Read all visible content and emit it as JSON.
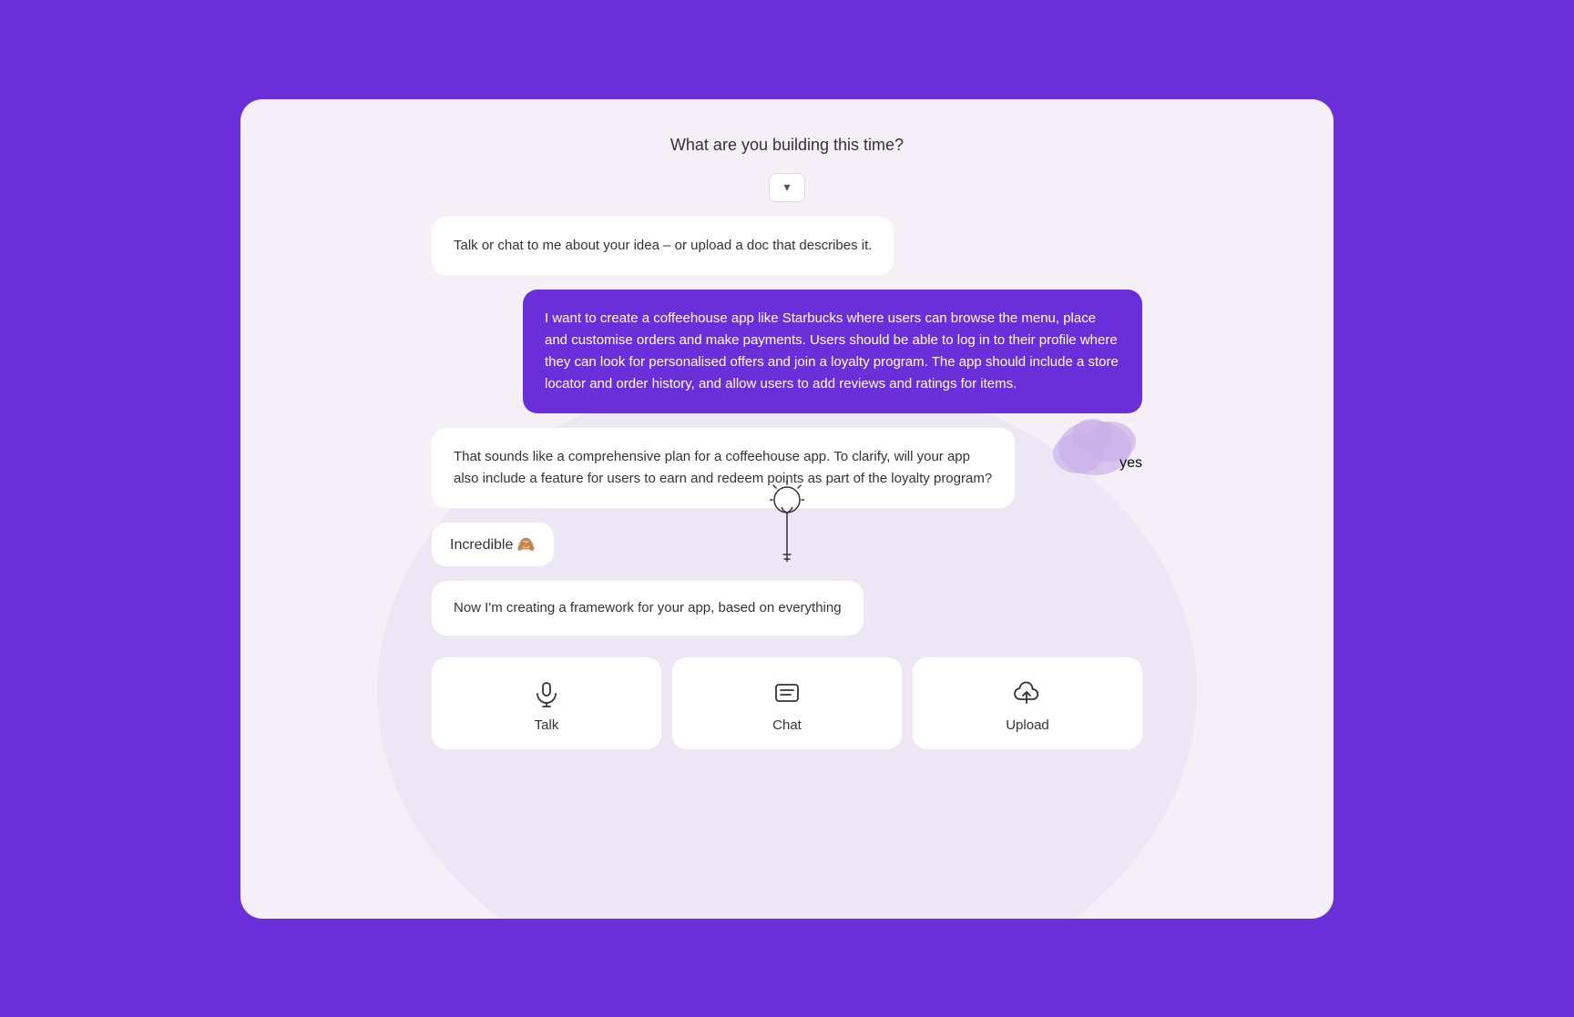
{
  "header": {
    "question": "What are you building this time?",
    "chevron": "▾"
  },
  "messages": [
    {
      "type": "ai",
      "text": "Talk or chat to me about your idea – or upload a doc that describes it."
    },
    {
      "type": "user",
      "text": "I want to create a coffeehouse app like Starbucks where users can browse the menu, place and customise orders and make payments. Users should be able to log in to their profile where they can look for personalised offers and join a loyalty program. The app should include a store locator and order history, and allow users to add reviews and ratings for items."
    },
    {
      "type": "ai",
      "text": "That sounds like a comprehensive plan for a coffeehouse app. To clarify, will your app also include a feature for users to earn and redeem points as part of the loyalty program?"
    },
    {
      "type": "user-short",
      "text": "yes"
    },
    {
      "type": "ai-short",
      "text": "Incredible 🙈"
    },
    {
      "type": "ai",
      "text": "Now I'm creating a framework for your app, based on everything"
    }
  ],
  "actions": [
    {
      "label": "Talk",
      "icon": "microphone"
    },
    {
      "label": "Chat",
      "icon": "chat"
    },
    {
      "label": "Upload",
      "icon": "upload"
    }
  ]
}
